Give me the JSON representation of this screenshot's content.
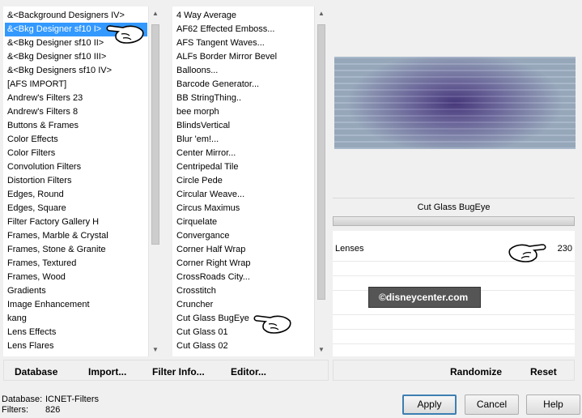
{
  "categories": {
    "items": [
      "&<Background Designers IV>",
      "&<Bkg Designer sf10 I>",
      "&<Bkg Designer sf10 II>",
      "&<Bkg Designer sf10 III>",
      "&<Bkg Designers sf10 IV>",
      "[AFS IMPORT]",
      "Andrew's Filters 23",
      "Andrew's Filters 8",
      "Buttons & Frames",
      "Color Effects",
      "Color Filters",
      "Convolution Filters",
      "Distortion Filters",
      "Edges, Round",
      "Edges, Square",
      "Filter Factory Gallery H",
      "Frames, Marble & Crystal",
      "Frames, Stone & Granite",
      "Frames, Textured",
      "Frames, Wood",
      "Gradients",
      "Image Enhancement",
      "kang",
      "Lens Effects",
      "Lens Flares"
    ],
    "selected_index": 1
  },
  "filters": {
    "items": [
      "4 Way Average",
      "AF62 Effected Emboss...",
      "AFS Tangent Waves...",
      "ALFs Border Mirror Bevel",
      "Balloons...",
      "Barcode Generator...",
      "BB StringThing..",
      "bee morph",
      "BlindsVertical",
      "Blur 'em!...",
      "Center Mirror...",
      "Centripedal Tile",
      "Circle Pede",
      "Circular Weave...",
      "Circus Maximus",
      "Cirquelate",
      "Convergance",
      "Corner Half Wrap",
      "Corner Right Wrap",
      "CrossRoads City...",
      "Crosstitch",
      "Cruncher",
      "Cut Glass  BugEye",
      "Cut Glass 01",
      "Cut Glass 02"
    ]
  },
  "preview": {
    "filter_title": "Cut Glass  BugEye",
    "colors": {
      "center": "#4a3a80",
      "edge": "#9fb0c4"
    }
  },
  "params": {
    "rows": [
      {
        "label": "Lenses",
        "value": "230"
      }
    ]
  },
  "watermark": {
    "text": "©disneycenter.com"
  },
  "toolbar": {
    "database": "Database",
    "import": "Import...",
    "filter_info": "Filter Info...",
    "editor": "Editor...",
    "randomize": "Randomize",
    "reset": "Reset"
  },
  "status": {
    "database_label": "Database:",
    "database_value": "ICNET-Filters",
    "filters_label": "Filters:",
    "filters_value": "826"
  },
  "buttons": {
    "apply": "Apply",
    "cancel": "Cancel",
    "help": "Help"
  }
}
